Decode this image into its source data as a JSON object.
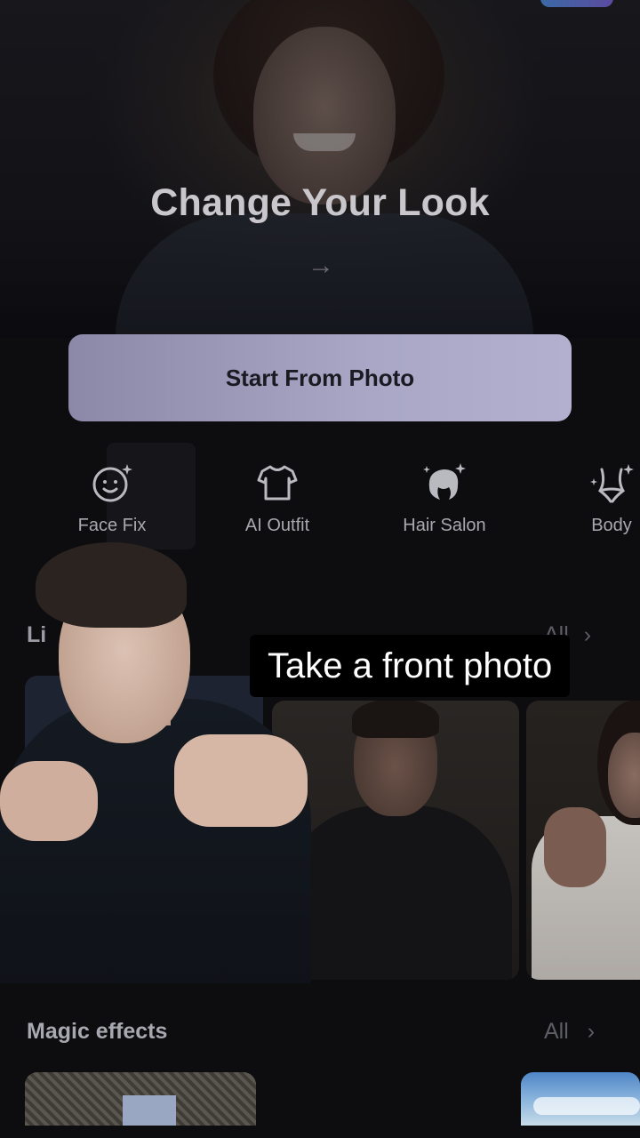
{
  "hero": {
    "title": "Change Your Look",
    "arrow_glyph": "→"
  },
  "start_button": {
    "label": "Start From Photo"
  },
  "tools": [
    {
      "label": "Face Fix",
      "icon": "face-sparkle-icon"
    },
    {
      "label": "AI Outfit",
      "icon": "tshirt-icon"
    },
    {
      "label": "Hair Salon",
      "icon": "hair-sparkle-icon"
    },
    {
      "label": "Body",
      "icon": "body-sparkle-icon"
    }
  ],
  "section_one": {
    "title_partial": "Li",
    "all_partial": "All",
    "chevron": "›"
  },
  "caption": {
    "text": "Take a front photo"
  },
  "section_two": {
    "title": "Magic effects",
    "all_label": "All",
    "chevron": "›"
  },
  "colors": {
    "background": "#0d0d10",
    "start_button": "#a9a6c6",
    "caption_bg": "#000000"
  }
}
